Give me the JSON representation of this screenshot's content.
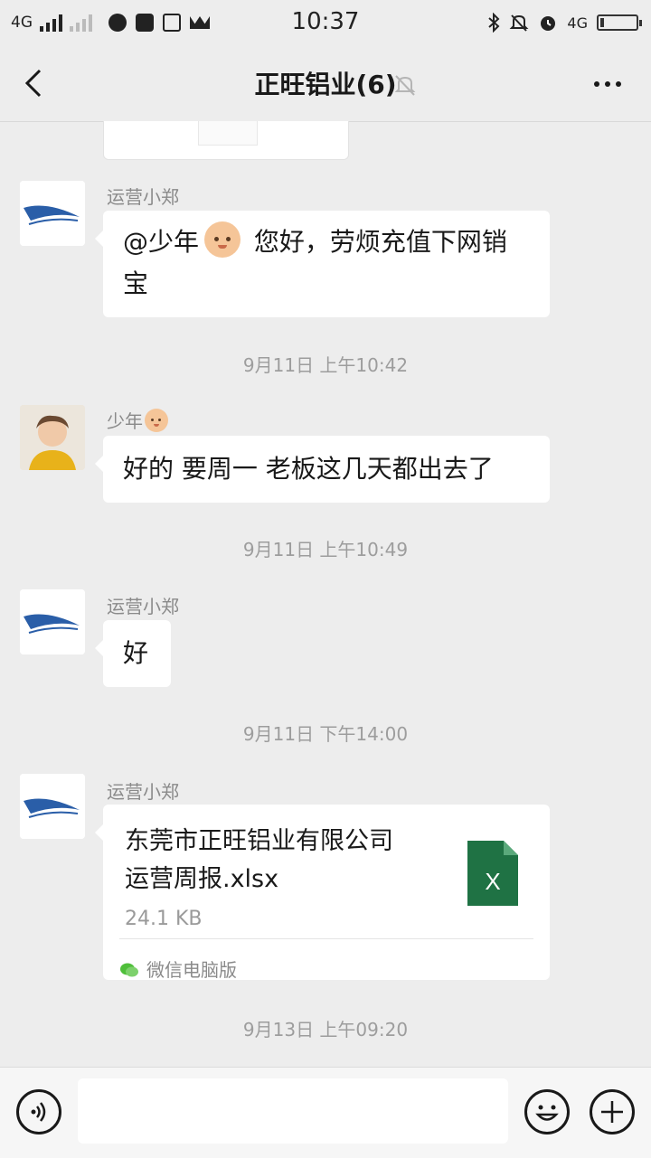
{
  "status_bar": {
    "network_left": "4G",
    "time": "10:37",
    "network_right": "4G"
  },
  "header": {
    "title": "正旺铝业(6)"
  },
  "messages": [
    {
      "sender": "运营小郑",
      "text_prefix": "@少年",
      "text_suffix": " 您好，劳烦充值下网销宝"
    },
    {
      "timestamp": "9月11日 上午10:42"
    },
    {
      "sender": "少年",
      "text": "好的 要周一 老板这几天都出去了"
    },
    {
      "timestamp": "9月11日 上午10:49"
    },
    {
      "sender": "运营小郑",
      "text": "好"
    },
    {
      "timestamp": "9月11日 下午14:00"
    },
    {
      "sender": "运营小郑",
      "file": {
        "name_line1": "东莞市正旺铝业有限公司",
        "name_line2": "运营周报.xlsx",
        "size": "24.1 KB",
        "icon_letter": "X",
        "source": "微信电脑版"
      }
    },
    {
      "timestamp": "9月13日 上午09:20"
    }
  ],
  "colors": {
    "background": "#ededed",
    "bubble": "#ffffff",
    "excel_green": "#1f7244",
    "wechat_green": "#4fbf3a"
  },
  "icons": [
    "back-icon",
    "mute-bell-icon",
    "more-icon",
    "voice-icon",
    "emoji-icon",
    "plus-icon",
    "excel-file-icon",
    "wechat-icon"
  ]
}
